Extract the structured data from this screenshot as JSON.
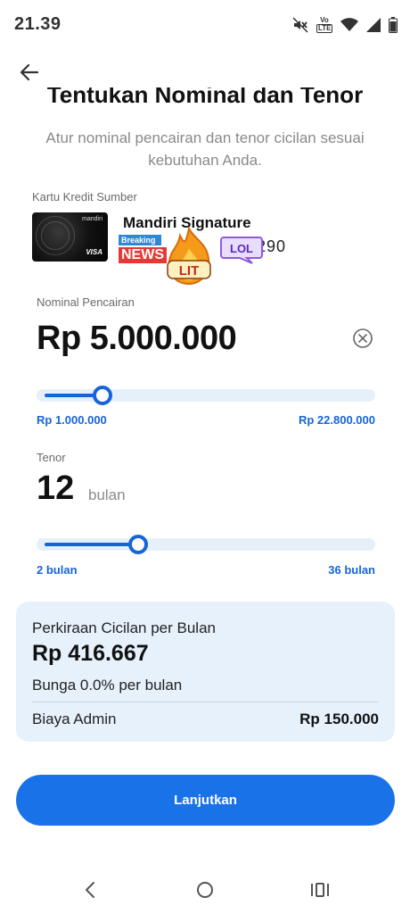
{
  "status_bar": {
    "time": "21.39",
    "volte_top": "Vo",
    "volte_bottom": "LTE",
    "icons": [
      "mute-icon",
      "volte-icon",
      "wifi-icon",
      "signal-icon",
      "battery-icon"
    ]
  },
  "header": {
    "back_icon": "arrow-left-icon",
    "title": "Tentukan Nominal dan Tenor",
    "subtitle": "Atur nominal pencairan dan tenor cicilan sesuai kebutuhan Anda."
  },
  "card": {
    "label": "Kartu Kredit Sumber",
    "name": "Mandiri Signature",
    "number_suffix": "290",
    "image_brand": "mandiri",
    "image_network": "VISA",
    "stickers": {
      "news_top": "Breaking",
      "news_bottom": "NEWS",
      "lit": "LIT",
      "lol": "LOL"
    }
  },
  "nominal": {
    "label": "Nominal Pencairan",
    "value": "Rp 5.000.000",
    "slider_min": "Rp 1.000.000",
    "slider_max": "Rp 22.800.000",
    "slider_fraction": 0.18,
    "clear_icon": "clear-circle-icon"
  },
  "tenor": {
    "label": "Tenor",
    "value": "12",
    "unit": "bulan",
    "slider_min": "2 bulan",
    "slider_max": "36 bulan",
    "slider_fraction": 0.29
  },
  "summary": {
    "title": "Perkiraan Cicilan per Bulan",
    "amount": "Rp 416.667",
    "rate": "Bunga 0.0% per bulan",
    "admin_label": "Biaya Admin",
    "admin_value": "Rp 150.000"
  },
  "cta": {
    "label": "Lanjutkan"
  },
  "nav": {
    "icons": [
      "nav-back-icon",
      "nav-home-icon",
      "nav-recents-icon"
    ]
  },
  "colors": {
    "accent": "#1565d8",
    "button": "#1a72e8",
    "summary_bg": "#e7f1fb",
    "slider_track": "#e6f0fb"
  }
}
